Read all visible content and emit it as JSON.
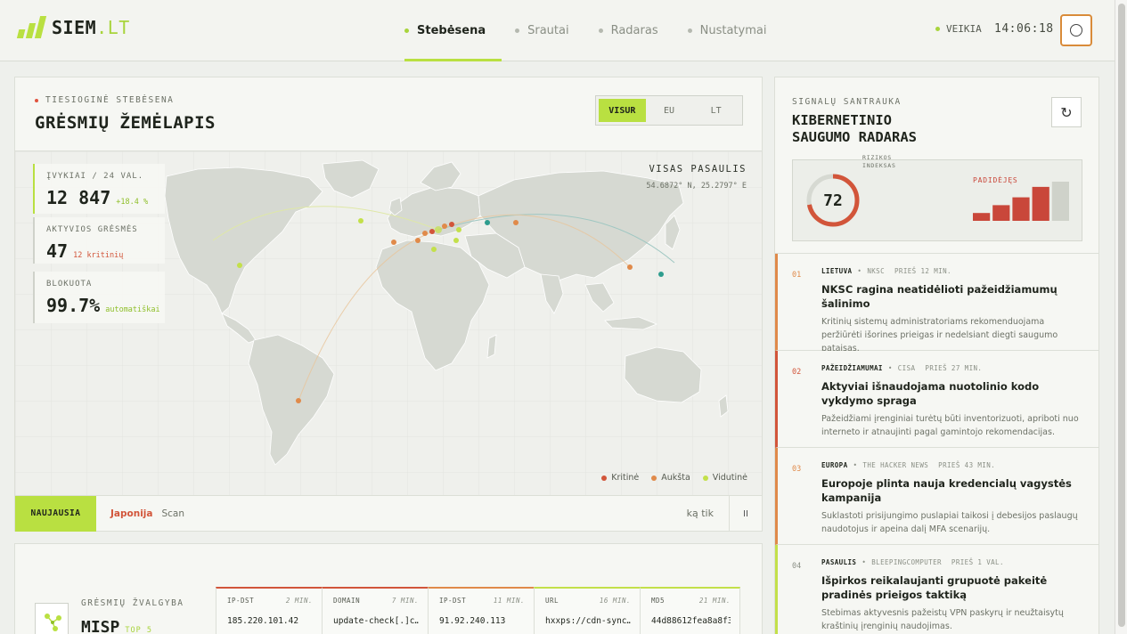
{
  "app": {
    "logo_main": "SIEM",
    "logo_accent": ".LT"
  },
  "nav": {
    "items": [
      {
        "label": "Stebėsena",
        "active": true
      },
      {
        "label": "Srautai",
        "active": false
      },
      {
        "label": "Radaras",
        "active": false
      },
      {
        "label": "Nustatymai",
        "active": false
      }
    ]
  },
  "header": {
    "status": "VEIKIA",
    "clock": "14:06:18",
    "user_icon": "circle-icon"
  },
  "map": {
    "section_label": "TIESIOGINĖ STEBĖSENA",
    "title": "GRĖSMIŲ ŽEMĖLAPIS",
    "filters": [
      {
        "label": "VISUR",
        "active": true
      },
      {
        "label": "EU",
        "active": false
      },
      {
        "label": "LT",
        "active": false
      }
    ],
    "region": "VISAS PASAULIS",
    "coords": "54.6872° N, 25.2797° E",
    "stats": [
      {
        "label": "ĮVYKIAI / 24 VAL.",
        "value": "12 847",
        "sub": "+18.4 %",
        "sub_color": "#8fbf2a"
      },
      {
        "label": "AKTYVIOS GRĖSMĖS",
        "value": "47",
        "sub": "12 kritinių",
        "sub_color": "#d2553a"
      },
      {
        "label": "BLOKUOTA",
        "value": "99.7%",
        "sub": "automatiškai",
        "sub_color": "#8fbf2a"
      }
    ],
    "legend": [
      {
        "label": "Kritinė",
        "color": "#d2553a"
      },
      {
        "label": "Aukšta",
        "color": "#e08a4a"
      },
      {
        "label": "Vidutinė",
        "color": "#c3e04a"
      }
    ]
  },
  "ticker": {
    "badge": "NAUJAUSIA",
    "highlight": "Japonija",
    "text": "Scan",
    "time": "ką tik",
    "pause": "II"
  },
  "intel": {
    "label": "GRĖSMIŲ ŽVALGYBA",
    "title": "MISP",
    "badge": "TOP 5",
    "iocs": [
      {
        "type": "IP-DST",
        "time": "2 MIN.",
        "value": "185.220.101.42",
        "color": "#d2553a"
      },
      {
        "type": "DOMAIN",
        "time": "7 MIN.",
        "value": "update-check[.]c…",
        "color": "#d2553a"
      },
      {
        "type": "IP-DST",
        "time": "11 MIN.",
        "value": "91.92.240.113",
        "color": "#e08a4a"
      },
      {
        "type": "URL",
        "time": "16 MIN.",
        "value": "hxxps://cdn-sync…",
        "color": "#c3e04a"
      },
      {
        "type": "MD5",
        "time": "21 MIN.",
        "value": "44d88612fea8a8f3…",
        "color": "#c3e04a"
      }
    ]
  },
  "radar": {
    "section_label": "SIGNALŲ SANTRAUKA",
    "title_line1": "KIBERNETINIO",
    "title_line2": "SAUGUMO RADARAS",
    "refresh_icon": "↻",
    "risk_label_1": "RIZIKOS",
    "risk_label_2": "INDEKSAS",
    "risk_index": 72,
    "trend_label": "PADIDĖJĘS",
    "trend_values": [
      3,
      6,
      9,
      13,
      15
    ],
    "gauge_color": "#d2553a",
    "news": [
      {
        "num": "01",
        "source": "LIETUVA",
        "agency": "NKSC",
        "time": "PRIEŠ 12 MIN.",
        "title": "NKSC ragina neatidėlioti pažeidžiamumų šalinimo",
        "body": "Kritinių sistemų administratoriams rekomenduojama peržiūrėti išorines prieigas ir nedelsiant diegti saugumo pataisas.",
        "color": "#e08a4a"
      },
      {
        "num": "02",
        "source": "PAŽEIDŽIAMUMAI",
        "agency": "CISA",
        "time": "PRIEŠ 27 MIN.",
        "title": "Aktyviai išnaudojama nuotolinio kodo vykdymo spraga",
        "body": "Pažeidžiami įrenginiai turėtų būti inventorizuoti, apriboti nuo interneto ir atnaujinti pagal gamintojo rekomendacijas.",
        "color": "#d2553a"
      },
      {
        "num": "03",
        "source": "EUROPA",
        "agency": "THE HACKER NEWS",
        "time": "PRIEŠ 43 MIN.",
        "title": "Europoje plinta nauja kredencialų vagystės kampanija",
        "body": "Suklastoti prisijungimo puslapiai taikosi į debesijos paslaugų naudotojus ir apeina dalį MFA scenarijų.",
        "color": "#e08a4a"
      },
      {
        "num": "04",
        "source": "PASAULIS",
        "agency": "BLEEPINGCOMPUTER",
        "time": "PRIEŠ 1 VAL.",
        "title": "Išpirkos reikalaujanti grupuotė pakeitė pradinės prieigos taktiką",
        "body": "Stebimas aktyvesnis pažeistų VPN paskyrų ir neužtaisytų kraštinių įrenginių naudojimas.",
        "color": "#c3e04a"
      }
    ]
  }
}
